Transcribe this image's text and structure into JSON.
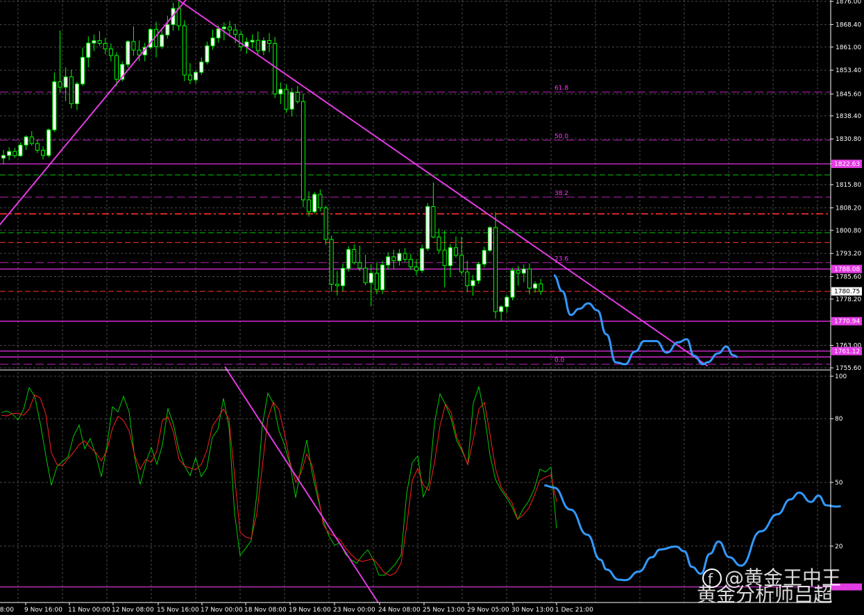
{
  "chart_data": [
    {
      "type": "candlestick",
      "title": "",
      "colors": {
        "up": "#ffffff",
        "down": "#00ff00",
        "trendline": "#e23ce2",
        "forecast": "#3399ff",
        "grid": "#4a4a4a"
      },
      "y_ticks": [
        "1876.00",
        "1868.40",
        "1861.00",
        "1853.40",
        "1845.60",
        "1838.40",
        "1830.80",
        "1822.60",
        "1815.80",
        "1808.20",
        "1800.80",
        "1793.20",
        "1785.60",
        "1778.20",
        "1763.00",
        "1755.60"
      ],
      "ylim": [
        1755.6,
        1876.0
      ],
      "x_labels": [
        "08:00",
        "9 Nov 16:00",
        "11 Nov 00:00",
        "12 Nov 08:00",
        "15 Nov 16:00",
        "17 Nov 00:00",
        "18 Nov 08:00",
        "19 Nov 16:00",
        "23 Nov 00:00",
        "24 Nov 08:00",
        "25 Nov 13:00",
        "29 Nov 05:00",
        "30 Nov 13:00",
        "1 Dec 21:00"
      ],
      "price_tags": [
        {
          "text": "1822.63",
          "value": 1822.63,
          "style": "magenta"
        },
        {
          "text": "1788.08",
          "value": 1788.08,
          "style": "magenta"
        },
        {
          "text": "1780.75",
          "value": 1780.75,
          "style": "current"
        },
        {
          "text": "1770.94",
          "value": 1770.94,
          "style": "magenta"
        },
        {
          "text": "1761.12",
          "value": 1761.12,
          "style": "magenta"
        }
      ],
      "fibonacci": [
        {
          "label": "61.8",
          "value": 1846.2
        },
        {
          "label": "50.0",
          "value": 1830.4
        },
        {
          "label": "38.2",
          "value": 1811.7
        },
        {
          "label": "23.6",
          "value": 1790.2
        },
        {
          "label": "0.0",
          "value": 1756.8
        }
      ],
      "h_lines": [
        {
          "value": 1822.63,
          "color": "#ff33ff",
          "style": "solid"
        },
        {
          "value": 1819.0,
          "color": "#00cc00",
          "style": "dash"
        },
        {
          "value": 1806.2,
          "color": "#ff3333",
          "style": "dashdot"
        },
        {
          "value": 1800.0,
          "color": "#00cc00",
          "style": "dash"
        },
        {
          "value": 1796.8,
          "color": "#ff3333",
          "style": "dash"
        },
        {
          "value": 1788.08,
          "color": "#ff33ff",
          "style": "solid"
        },
        {
          "value": 1780.75,
          "color": "#ff3333",
          "style": "dash"
        },
        {
          "value": 1770.94,
          "color": "#ff33ff",
          "style": "solid"
        },
        {
          "value": 1761.12,
          "color": "#ff33ff",
          "style": "solid"
        },
        {
          "value": 1759.2,
          "color": "#ff33ff",
          "style": "solid"
        }
      ],
      "candles": [
        [
          1824.5,
          1827.2,
          1822.6,
          1825.4
        ],
        [
          1825.4,
          1828.1,
          1823.8,
          1826.7
        ],
        [
          1826.7,
          1827.9,
          1824.6,
          1825.3
        ],
        [
          1825.3,
          1829.7,
          1824.9,
          1828.8
        ],
        [
          1828.8,
          1832.0,
          1827.2,
          1831.5
        ],
        [
          1831.5,
          1833.4,
          1828.6,
          1829.3
        ],
        [
          1829.3,
          1830.6,
          1826.2,
          1827.1
        ],
        [
          1827.1,
          1828.4,
          1824.1,
          1825.4
        ],
        [
          1825.4,
          1834.2,
          1824.8,
          1833.8
        ],
        [
          1833.8,
          1852.6,
          1833.1,
          1849.6
        ],
        [
          1849.6,
          1866.4,
          1846.2,
          1847.8
        ],
        [
          1847.8,
          1854.3,
          1843.2,
          1851.2
        ],
        [
          1851.2,
          1853.6,
          1840.8,
          1842.4
        ],
        [
          1842.4,
          1849.6,
          1840.3,
          1848.9
        ],
        [
          1848.9,
          1860.8,
          1848.2,
          1857.6
        ],
        [
          1857.6,
          1864.5,
          1854.3,
          1862.3
        ],
        [
          1862.3,
          1865.1,
          1859.7,
          1863.1
        ],
        [
          1863.1,
          1866.2,
          1861.4,
          1862.2
        ],
        [
          1862.2,
          1864.0,
          1858.6,
          1860.4
        ],
        [
          1860.4,
          1862.1,
          1856.3,
          1858.2
        ],
        [
          1858.2,
          1859.3,
          1848.1,
          1850.4
        ],
        [
          1850.4,
          1856.4,
          1849.7,
          1855.3
        ],
        [
          1855.3,
          1863.3,
          1854.3,
          1862.8
        ],
        [
          1862.8,
          1867.8,
          1858.2,
          1860.0
        ],
        [
          1860.0,
          1863.2,
          1856.4,
          1858.4
        ],
        [
          1858.4,
          1862.4,
          1856.3,
          1860.9
        ],
        [
          1860.9,
          1867.3,
          1860.2,
          1866.8
        ],
        [
          1866.8,
          1869.3,
          1857.6,
          1861.2
        ],
        [
          1861.2,
          1866.6,
          1860.4,
          1865.0
        ],
        [
          1865.0,
          1871.3,
          1863.8,
          1868.4
        ],
        [
          1868.4,
          1875.6,
          1866.3,
          1873.7
        ],
        [
          1873.7,
          1876.0,
          1866.4,
          1868.0
        ],
        [
          1868.0,
          1869.8,
          1849.8,
          1851.8
        ],
        [
          1851.8,
          1855.7,
          1848.8,
          1850.2
        ],
        [
          1850.2,
          1853.4,
          1849.1,
          1852.7
        ],
        [
          1852.7,
          1857.6,
          1851.8,
          1856.1
        ],
        [
          1856.1,
          1862.8,
          1855.3,
          1861.4
        ],
        [
          1861.4,
          1866.8,
          1860.1,
          1864.0
        ],
        [
          1864.0,
          1868.1,
          1862.4,
          1867.0
        ],
        [
          1867.0,
          1869.1,
          1863.2,
          1867.6
        ],
        [
          1867.6,
          1869.6,
          1864.3,
          1866.6
        ],
        [
          1866.6,
          1868.6,
          1862.3,
          1865.2
        ],
        [
          1865.2,
          1866.3,
          1859.8,
          1861.1
        ],
        [
          1861.1,
          1864.1,
          1858.8,
          1862.7
        ],
        [
          1862.7,
          1865.2,
          1860.6,
          1863.2
        ],
        [
          1863.2,
          1866.1,
          1858.3,
          1859.8
        ],
        [
          1859.8,
          1864.2,
          1858.3,
          1863.1
        ],
        [
          1863.1,
          1865.6,
          1859.3,
          1862.2
        ],
        [
          1862.2,
          1864.3,
          1844.2,
          1845.6
        ],
        [
          1845.6,
          1849.4,
          1842.3,
          1847.1
        ],
        [
          1847.1,
          1848.8,
          1839.4,
          1840.6
        ],
        [
          1840.6,
          1847.6,
          1838.2,
          1846.1
        ],
        [
          1846.1,
          1848.3,
          1842.4,
          1843.1
        ],
        [
          1843.1,
          1845.7,
          1808.4,
          1810.8
        ],
        [
          1810.8,
          1813.6,
          1805.3,
          1806.9
        ],
        [
          1806.9,
          1813.4,
          1806.3,
          1812.6
        ],
        [
          1812.6,
          1814.2,
          1807.0,
          1808.2
        ],
        [
          1808.2,
          1808.9,
          1796.1,
          1797.8
        ],
        [
          1797.8,
          1799.1,
          1780.6,
          1783.1
        ],
        [
          1783.1,
          1787.4,
          1779.4,
          1782.6
        ],
        [
          1782.6,
          1789.9,
          1780.8,
          1788.3
        ],
        [
          1788.3,
          1795.6,
          1787.2,
          1794.5
        ],
        [
          1794.5,
          1796.2,
          1789.6,
          1790.2
        ],
        [
          1790.2,
          1795.8,
          1787.4,
          1788.4
        ],
        [
          1788.4,
          1792.8,
          1782.7,
          1783.6
        ],
        [
          1783.6,
          1789.7,
          1775.8,
          1786.7
        ],
        [
          1786.7,
          1790.2,
          1779.8,
          1781.3
        ],
        [
          1781.3,
          1790.8,
          1779.9,
          1789.4
        ],
        [
          1789.4,
          1793.6,
          1787.9,
          1792.1
        ],
        [
          1792.1,
          1794.4,
          1788.2,
          1790.8
        ],
        [
          1790.8,
          1794.6,
          1789.2,
          1793.2
        ],
        [
          1793.2,
          1795.0,
          1790.4,
          1791.3
        ],
        [
          1791.3,
          1793.1,
          1787.8,
          1788.8
        ],
        [
          1788.8,
          1791.3,
          1786.0,
          1787.6
        ],
        [
          1787.6,
          1796.1,
          1786.8,
          1794.8
        ],
        [
          1794.8,
          1809.7,
          1794.0,
          1808.6
        ],
        [
          1808.6,
          1816.5,
          1798.2,
          1798.6
        ],
        [
          1798.6,
          1801.4,
          1793.2,
          1794.3
        ],
        [
          1794.3,
          1800.8,
          1782.1,
          1789.2
        ],
        [
          1789.2,
          1796.3,
          1785.4,
          1795.1
        ],
        [
          1795.1,
          1798.8,
          1791.8,
          1792.6
        ],
        [
          1792.6,
          1798.7,
          1786.2,
          1787.1
        ],
        [
          1787.1,
          1790.8,
          1780.5,
          1782.6
        ],
        [
          1782.6,
          1786.1,
          1779.3,
          1784.3
        ],
        [
          1784.3,
          1790.4,
          1783.2,
          1789.7
        ],
        [
          1789.7,
          1795.4,
          1788.6,
          1794.2
        ],
        [
          1794.2,
          1802.2,
          1793.6,
          1801.7
        ],
        [
          1801.7,
          1806.7,
          1771.8,
          1774.1
        ],
        [
          1774.1,
          1776.2,
          1771.1,
          1775.7
        ],
        [
          1775.7,
          1779.6,
          1773.8,
          1778.8
        ],
        [
          1778.8,
          1788.4,
          1777.8,
          1787.6
        ],
        [
          1787.6,
          1789.2,
          1782.6,
          1786.7
        ],
        [
          1786.7,
          1789.6,
          1783.8,
          1788.1
        ],
        [
          1788.1,
          1790.0,
          1779.8,
          1781.8
        ],
        [
          1781.8,
          1784.0,
          1780.3,
          1783.2
        ],
        [
          1783.2,
          1784.8,
          1779.6,
          1780.75
        ]
      ],
      "trendlines": [
        {
          "from": [
            -2,
            1799.6
          ],
          "to": [
            32.5,
            1877.0
          ]
        },
        {
          "from": [
            30.5,
            1877.0
          ],
          "to": [
            124.5,
            1756.2
          ]
        }
      ],
      "forecast": [
        [
          97.3,
          1786.0
        ],
        [
          98.8,
          1780.8
        ],
        [
          100.3,
          1773.0
        ],
        [
          101.8,
          1775.0
        ],
        [
          103.4,
          1776.8
        ],
        [
          105.0,
          1774.5
        ],
        [
          106.6,
          1766.6
        ],
        [
          108.3,
          1757.4
        ],
        [
          109.9,
          1756.8
        ],
        [
          111.7,
          1761.0
        ],
        [
          113.3,
          1764.4
        ],
        [
          115.4,
          1764.4
        ],
        [
          117.3,
          1760.6
        ],
        [
          119.3,
          1764.0
        ],
        [
          120.8,
          1765.0
        ],
        [
          122.1,
          1759.6
        ],
        [
          123.7,
          1756.8
        ],
        [
          124.4,
          1757.4
        ],
        [
          126.4,
          1760.4
        ],
        [
          127.8,
          1762.6
        ],
        [
          129.0,
          1759.8
        ],
        [
          129.8,
          1759.2
        ]
      ]
    },
    {
      "type": "line",
      "title": "",
      "y_ticks": [
        "100",
        "80",
        "50",
        "20"
      ],
      "ylim": [
        0,
        100
      ],
      "series": [
        {
          "color": "#00cc00",
          "values": [
            82.9,
            83.7,
            82.2,
            79.4,
            84.4,
            94.6,
            90.6,
            77.9,
            62.7,
            48.6,
            57.4,
            59.8,
            62.0,
            71.8,
            77.0,
            65.9,
            70.6,
            63.2,
            52.7,
            67.1,
            85.6,
            83.2,
            90.5,
            83.3,
            61.9,
            49.0,
            59.2,
            66.5,
            58.5,
            67.6,
            84.9,
            77.2,
            65.1,
            57.8,
            53.2,
            61.7,
            52.7,
            56.8,
            71.3,
            74.9,
            89.6,
            76.1,
            35.4,
            15.6,
            19.0,
            22.5,
            44.1,
            76.9,
            92.0,
            87.2,
            74.4,
            67.6,
            58.3,
            42.8,
            57.3,
            70.0,
            54.1,
            42.6,
            31.8,
            24.7,
            20.5,
            21.5,
            16.1,
            13.6,
            11.9,
            15.6,
            18.2,
            13.5,
            6.4,
            6.3,
            8.9,
            11.7,
            15.8,
            44.9,
            59.2,
            62.5,
            43.2,
            49.5,
            77.7,
            91.7,
            86.6,
            80.2,
            69.7,
            64.8,
            58.5,
            87.4,
            95.0,
            81.9,
            62.9,
            51.4,
            46.5,
            42.8,
            38.4,
            32.5,
            37.6,
            41.3,
            47.0,
            56.2,
            54.9,
            57.2,
            28.4
          ]
        },
        {
          "color": "#ff2020",
          "values": [
            81.7,
            81.3,
            82.4,
            82.6,
            81.6,
            84.5,
            91.2,
            89.7,
            82.2,
            64.0,
            58.5,
            57.8,
            61.2,
            64.1,
            67.8,
            69.6,
            66.5,
            64.1,
            60.1,
            65.0,
            75.4,
            81.2,
            79.1,
            74.3,
            62.8,
            56.1,
            60.8,
            59.5,
            64.8,
            79.2,
            80.9,
            73.4,
            60.9,
            57.7,
            56.8,
            55.9,
            58.5,
            64.9,
            76.4,
            80.3,
            84.6,
            79.6,
            53.3,
            26.5,
            24.3,
            23.5,
            35.2,
            57.4,
            80.4,
            87.8,
            84.2,
            73.1,
            59.5,
            50.1,
            54.7,
            63.4,
            57.8,
            44.9,
            30.0,
            26.0,
            24.6,
            23.0,
            19.1,
            16.1,
            13.6,
            12.8,
            13.4,
            14.0,
            10.8,
            7.4,
            6.2,
            7.4,
            12.1,
            29.4,
            50.8,
            56.6,
            48.7,
            46.2,
            59.1,
            76.7,
            86.9,
            83.0,
            71.6,
            65.5,
            58.3,
            70.2,
            84.5,
            87.6,
            72.9,
            56.5,
            47.9,
            43.8,
            40.3,
            32.7,
            34.7,
            37.9,
            43.9,
            50.9,
            52.4,
            53.6,
            40.8
          ]
        }
      ],
      "trendline": {
        "from": [
          0,
          104.5
        ],
        "to": [
          23.1,
          -6.5
        ]
      },
      "h_line": 0.8,
      "forecast": [
        [
          97.8,
          48.6
        ],
        [
          99.5,
          47.6
        ],
        [
          102.5,
          37.2
        ],
        [
          105.5,
          25.4
        ],
        [
          107.9,
          13.6
        ],
        [
          109.0,
          9.0
        ],
        [
          111.2,
          4.2
        ],
        [
          112.4,
          4.0
        ],
        [
          114.8,
          8.0
        ],
        [
          117.2,
          14.8
        ],
        [
          118.6,
          18.4
        ],
        [
          121.5,
          19.8
        ],
        [
          123.0,
          17.6
        ],
        [
          124.4,
          10.2
        ],
        [
          126.0,
          7.0
        ],
        [
          127.6,
          16.4
        ],
        [
          129.2,
          22.2
        ],
        [
          131.1,
          14.8
        ],
        [
          133.2,
          10.8
        ],
        [
          136.8,
          27.0
        ],
        [
          139.8,
          35.0
        ],
        [
          142.1,
          42.0
        ],
        [
          143.7,
          45.2
        ],
        [
          145.8,
          40.8
        ],
        [
          147.2,
          43.8
        ],
        [
          148.6,
          39.2
        ],
        [
          150.4,
          38.6
        ],
        [
          151.2,
          38.8
        ]
      ]
    }
  ],
  "watermark": {
    "logo_text": "f",
    "line1": "@黄金王中王",
    "line2": "黄金分析师吕超"
  }
}
